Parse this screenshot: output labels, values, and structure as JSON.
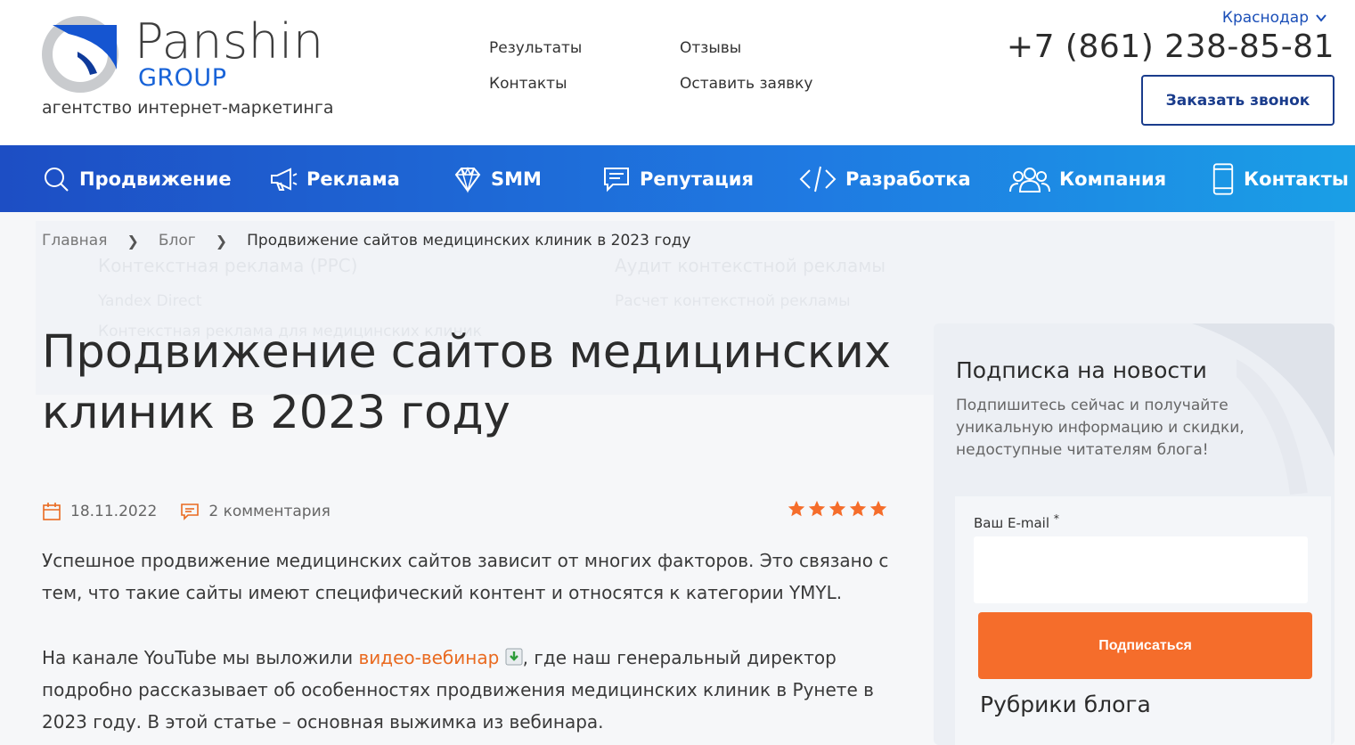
{
  "header": {
    "logo_name": "Panshin",
    "logo_group": "GROUP",
    "tagline": "агентство интернет-маркетинга",
    "top_nav": [
      "Результаты",
      "Отзывы",
      "Контакты",
      "Оставить заявку"
    ],
    "city": "Краснодар",
    "phone": "+7 (861) 238-85-81",
    "callback_label": "Заказать звонок"
  },
  "main_nav": [
    {
      "label": "Продвижение",
      "icon": "search-icon"
    },
    {
      "label": "Реклама",
      "icon": "megaphone-icon"
    },
    {
      "label": "SMM",
      "icon": "diamond-icon"
    },
    {
      "label": "Репутация",
      "icon": "message-icon"
    },
    {
      "label": "Разработка",
      "icon": "code-icon"
    },
    {
      "label": "Компания",
      "icon": "people-icon"
    },
    {
      "label": "Контакты",
      "icon": "phone-icon"
    }
  ],
  "breadcrumb": {
    "home": "Главная",
    "blog": "Блог",
    "current": "Продвижение сайтов медицинских клиник в 2023 году"
  },
  "ghost_menu": {
    "col1_title": "Контекстная реклама (PPC)",
    "col1_item1": "Yandex Direct",
    "col1_item2": "Контекстная реклама для медицинских клиник",
    "col2_title": "Аудит контекстной рекламы",
    "col2_item1": "Расчет контекстной рекламы"
  },
  "article": {
    "title": "Продвижение сайтов медицинских клиник в 2023 году",
    "date": "18.11.2022",
    "comments": "2 комментария",
    "rating_stars": 5,
    "para1": "Успешное продвижение медицинских сайтов зависит от многих факторов. Это связано с тем, что такие сайты имеют специфический контент и относятся к категории YMYL.",
    "para2_start": "На канале YouTube мы выложили ",
    "para2_link": "видео-вебинар",
    "para2_end": ", где наш генеральный директор подробно рассказывает об особенностях продвижения медицинских клиник в Рунете в 2023 году. В этой статье – основная выжимка из вебинара."
  },
  "sidebar": {
    "title": "Подписка на новости",
    "description": "Подпишитесь сейчас и получайте уникальную информацию и скидки, недоступные читателям блога!",
    "email_label": "Ваш E-mail",
    "required_mark": "*",
    "email_value": "",
    "subscribe_label": "Подписаться",
    "rubrics_title": "Рубрики блога"
  },
  "colors": {
    "nav_gradient_start": "#1d4ec4",
    "nav_gradient_end": "#1a9fe6",
    "accent_orange": "#f56d2b",
    "brand_blue": "#1863d8"
  }
}
